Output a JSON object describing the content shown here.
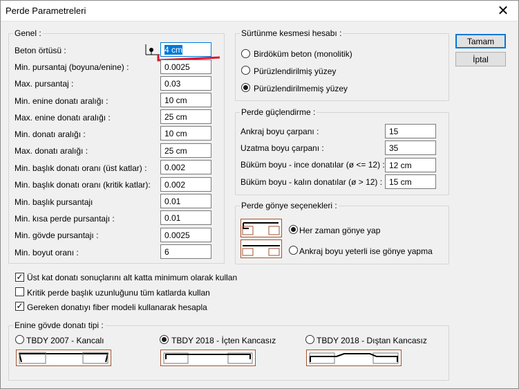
{
  "window": {
    "title": "Perde Parametreleri",
    "close_symbol": "✕"
  },
  "buttons": {
    "ok": "Tamam",
    "cancel": "İptal"
  },
  "genel": {
    "legend": "Genel :",
    "rows": [
      {
        "label": "Beton örtüsü :",
        "value": "4 cm"
      },
      {
        "label": "Min.  pursantaj (boyuna/enine) :",
        "value": "0.0025"
      },
      {
        "label": "Max. pursantaj :",
        "value": "0.03"
      },
      {
        "label": "Min. enine donatı aralığı :",
        "value": "10 cm"
      },
      {
        "label": "Max. enine donatı aralığı :",
        "value": "25 cm"
      },
      {
        "label": "Min. donatı aralığı :",
        "value": "10 cm"
      },
      {
        "label": "Max. donatı aralığı :",
        "value": "25 cm"
      },
      {
        "label": "Min. başlık donatı oranı (üst katlar) :",
        "value": "0.002"
      },
      {
        "label": "Min. başlık donatı oranı (kritik katlar):",
        "value": "0.002"
      },
      {
        "label": "Min. başlık pursantajı",
        "value": "0.01"
      },
      {
        "label": "Min. kısa perde pursantajı :",
        "value": "0.01"
      },
      {
        "label": "Min. gövde pursantajı :",
        "value": "0.0025"
      },
      {
        "label": "Min. boyut oranı :",
        "value": "6"
      }
    ]
  },
  "surtunme": {
    "legend": "Sürtünme kesmesi hesabı :",
    "options": [
      {
        "label": "Birdöküm beton (monolitik)",
        "checked": false
      },
      {
        "label": "Pürüzlendirilmiş yüzey",
        "checked": false
      },
      {
        "label": "Pürüzlendirilmemiş yüzey",
        "checked": true
      }
    ]
  },
  "guclendirme": {
    "legend": "Perde güçlendirme :",
    "rows": [
      {
        "label": "Ankraj boyu çarpanı :",
        "value": "15"
      },
      {
        "label": "Uzatma boyu çarpanı :",
        "value": "35"
      },
      {
        "label": "Büküm boyu - ince donatılar (ø <= 12) :",
        "value": "12 cm"
      },
      {
        "label": "Büküm boyu - kalın donatılar (ø > 12) :",
        "value": "15 cm"
      }
    ]
  },
  "gonye": {
    "legend": "Perde gönye seçenekleri :",
    "options": [
      {
        "label": "Her zaman gönye yap",
        "checked": true
      },
      {
        "label": "Ankraj boyu yeterli ise gönye yapma",
        "checked": false
      }
    ]
  },
  "checkboxes": [
    {
      "label": "Üst kat donatı sonuçlarını alt katta minimum olarak kullan",
      "checked": true
    },
    {
      "label": "Kritik perde başlık uzunluğunu tüm katlarda kullan",
      "checked": false
    },
    {
      "label": "Gereken donatıyı fiber modeli kullanarak hesapla",
      "checked": true
    }
  ],
  "enine": {
    "legend": "Enine gövde donatı tipi :",
    "options": [
      {
        "label": "TBDY 2007 - Kancalı",
        "checked": false
      },
      {
        "label": "TBDY 2018 - İçten Kancasız",
        "checked": true
      },
      {
        "label": "TBDY 2018 - Dıştan Kancasız",
        "checked": false
      }
    ]
  },
  "colors": {
    "annotation_red": "#e0142a",
    "focus_blue": "#0078d7",
    "drawing_brown": "#a0522d"
  }
}
